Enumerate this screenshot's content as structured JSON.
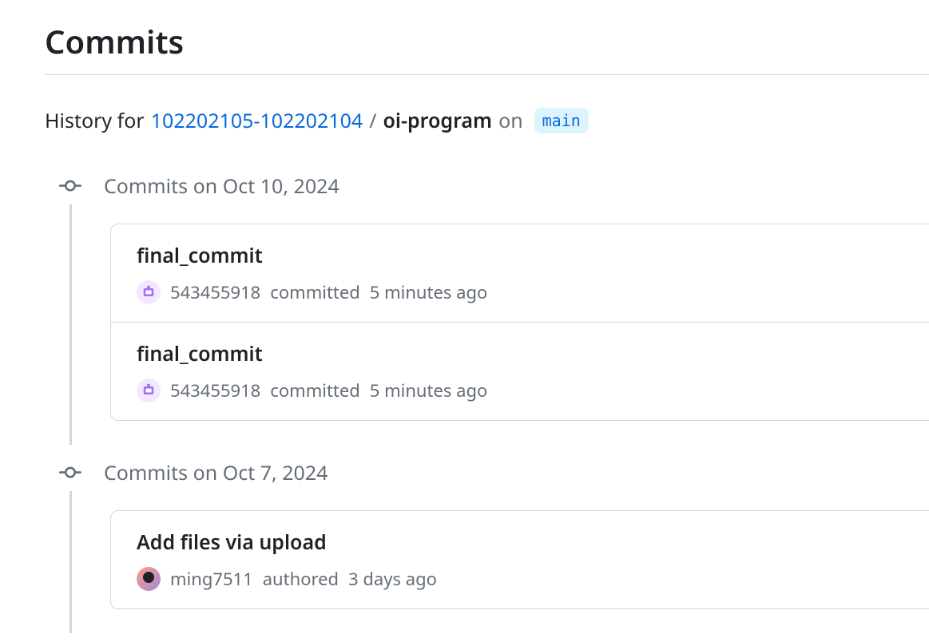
{
  "page_title": "Commits",
  "history": {
    "prefix": "History for",
    "repo_link": "102202105-102202104",
    "separator": "/",
    "path": "oi-program",
    "on_label": "on",
    "branch": "main"
  },
  "groups": [
    {
      "date_label": "Commits on Oct 10, 2024",
      "commits": [
        {
          "title": "final_commit",
          "author": "543455918",
          "action": "committed",
          "time": "5 minutes ago",
          "avatar_type": "bot"
        },
        {
          "title": "final_commit",
          "author": "543455918",
          "action": "committed",
          "time": "5 minutes ago",
          "avatar_type": "bot"
        }
      ]
    },
    {
      "date_label": "Commits on Oct 7, 2024",
      "commits": [
        {
          "title": "Add files via upload",
          "author": "ming7511",
          "action": "authored",
          "time": "3 days ago",
          "avatar_type": "user"
        }
      ]
    }
  ]
}
